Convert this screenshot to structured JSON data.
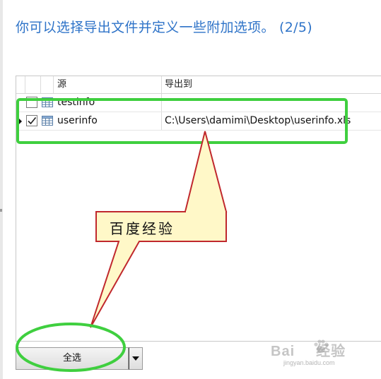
{
  "header": {
    "title": "你可以选择导出文件并定义一些附加选项。 (2/5)"
  },
  "grid": {
    "columns": [
      "源",
      "导出到"
    ],
    "rows": [
      {
        "name": "testinfo",
        "path": "",
        "checked": false,
        "current": false
      },
      {
        "name": "userinfo",
        "path": "C:\\Users\\damimi\\Desktop\\userinfo.xls",
        "checked": true,
        "current": true
      }
    ]
  },
  "footer": {
    "select_all_label": "全选"
  },
  "annotation": {
    "callout_text": "百度经验"
  },
  "watermark": {
    "brand": "Bai",
    "brand_suffix": "经验",
    "url": "jingyan.baidu.com"
  },
  "colors": {
    "title": "#2e73c8",
    "highlight_green": "#3fcf3f",
    "callout_fill": "#fff8c8",
    "callout_border": "#c0282d"
  },
  "icons": [
    "table-icon",
    "checkbox-icon",
    "row-pointer-icon",
    "dropdown-arrow-icon",
    "baidu-paw-icon"
  ]
}
